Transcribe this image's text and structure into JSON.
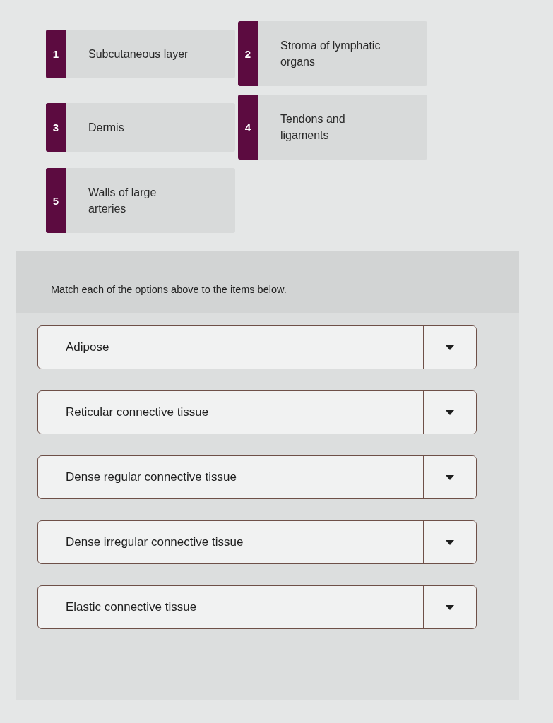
{
  "options": [
    {
      "number": "1",
      "label": "Subcutaneous layer"
    },
    {
      "number": "2",
      "label": "Stroma of lymphatic organs"
    },
    {
      "number": "3",
      "label": "Dermis"
    },
    {
      "number": "4",
      "label": "Tendons and ligaments"
    },
    {
      "number": "5",
      "label": "Walls of large arteries"
    }
  ],
  "question": {
    "instruction": "Match each of the options above to the items below.",
    "items": [
      {
        "label": "Adipose"
      },
      {
        "label": "Reticular connective tissue"
      },
      {
        "label": "Dense regular connective tissue"
      },
      {
        "label": "Dense irregular connective tissue"
      },
      {
        "label": "Elastic connective tissue"
      }
    ]
  }
}
